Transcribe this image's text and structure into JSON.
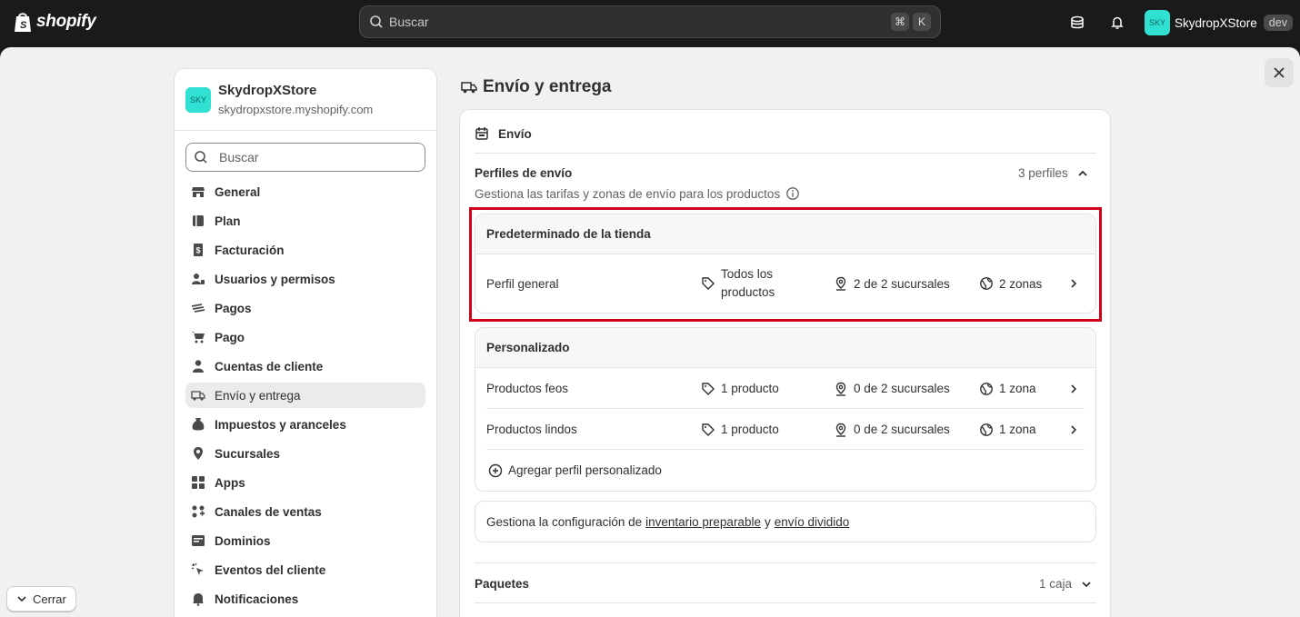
{
  "topbar": {
    "brand": "shopify",
    "search_placeholder": "Buscar",
    "shortcut_keys": [
      "⌘",
      "K"
    ],
    "store_name": "SkydropXStore",
    "store_avatar": "SKY",
    "env_badge": "dev"
  },
  "sidebar": {
    "store_name": "SkydropXStore",
    "store_url": "skydropxstore.myshopify.com",
    "store_avatar": "SKY",
    "search_placeholder": "Buscar",
    "items": [
      {
        "label": "General",
        "icon": "store-icon"
      },
      {
        "label": "Plan",
        "icon": "plan-icon"
      },
      {
        "label": "Facturación",
        "icon": "receipt-icon"
      },
      {
        "label": "Usuarios y permisos",
        "icon": "users-icon"
      },
      {
        "label": "Pagos",
        "icon": "payments-icon"
      },
      {
        "label": "Pago",
        "icon": "cart-icon"
      },
      {
        "label": "Cuentas de cliente",
        "icon": "person-icon"
      },
      {
        "label": "Envío y entrega",
        "icon": "truck-icon",
        "active": true
      },
      {
        "label": "Impuestos y aranceles",
        "icon": "tax-icon"
      },
      {
        "label": "Sucursales",
        "icon": "location-icon"
      },
      {
        "label": "Apps",
        "icon": "apps-icon"
      },
      {
        "label": "Canales de ventas",
        "icon": "channels-icon"
      },
      {
        "label": "Dominios",
        "icon": "globe-icon"
      },
      {
        "label": "Eventos del cliente",
        "icon": "cursor-icon"
      },
      {
        "label": "Notificaciones",
        "icon": "bell-icon"
      }
    ]
  },
  "close_bar": {
    "label": "Cerrar"
  },
  "page": {
    "title": "Envío y entrega",
    "card_title": "Envío",
    "profiles": {
      "title": "Perfiles de envío",
      "count": "3 perfiles",
      "subtitle": "Gestiona las tarifas y zonas de envío para los productos"
    },
    "default_group": {
      "title": "Predeterminado de la tienda",
      "row": {
        "name": "Perfil general",
        "products_line1": "Todos los",
        "products_line2": "productos",
        "locations": "2 de 2 sucursales",
        "zones": "2 zonas"
      }
    },
    "custom_group": {
      "title": "Personalizado",
      "rows": [
        {
          "name": "Productos feos",
          "products": "1 producto",
          "locations": "0 de 2 sucursales",
          "zones": "1 zona"
        },
        {
          "name": "Productos lindos",
          "products": "1 producto",
          "locations": "0 de 2 sucursales",
          "zones": "1 zona"
        }
      ],
      "add_label": "Agregar perfil personalizado"
    },
    "inventory": {
      "prefix": "Gestiona la configuración de",
      "link1": "inventario preparable",
      "conj": "y",
      "link2": "envío dividido"
    },
    "packages": {
      "title": "Paquetes",
      "count": "1 caja"
    }
  },
  "colors": {
    "highlight": "#d0021b",
    "topbar": "#1a1a1a",
    "store_avatar": "#2fe0d3"
  }
}
